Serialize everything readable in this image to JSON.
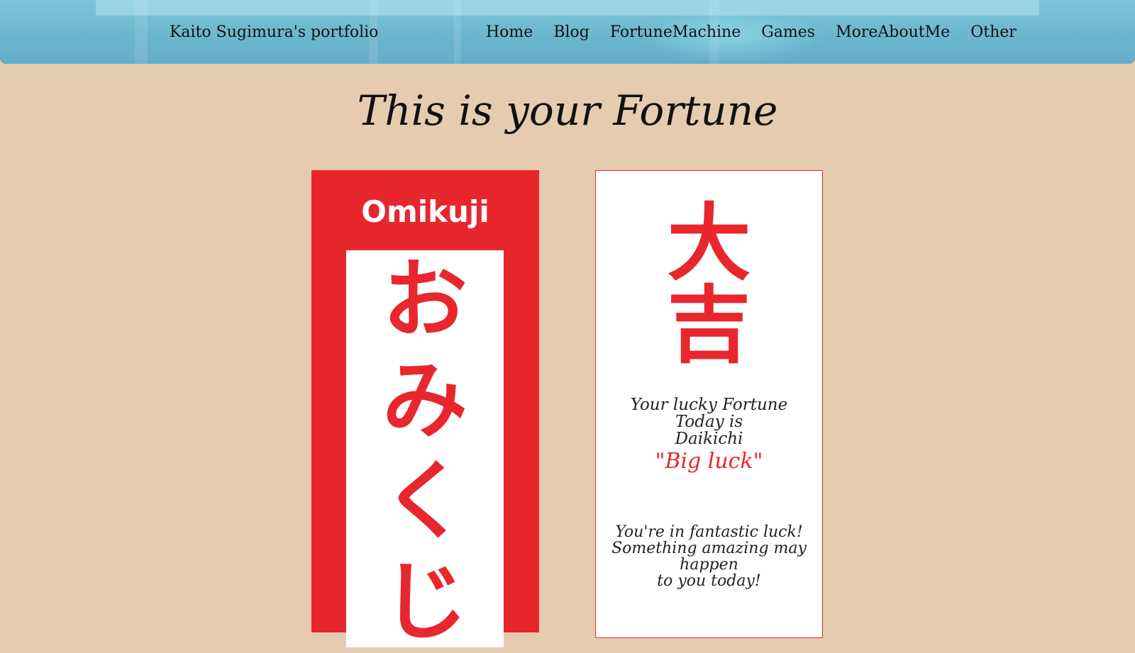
{
  "header": {
    "brand": "Kaito Sugimura's portfolio",
    "nav": [
      {
        "label": "Home"
      },
      {
        "label": "Blog"
      },
      {
        "label": "FortuneMachine"
      },
      {
        "label": "Games"
      },
      {
        "label": "MoreAboutMe"
      },
      {
        "label": "Other"
      }
    ]
  },
  "main": {
    "title": "This is your Fortune",
    "omikuji": {
      "title": "Omikuji",
      "kana": [
        "お",
        "み",
        "く",
        "じ"
      ]
    },
    "fortune": {
      "kanji": [
        "大",
        "吉"
      ],
      "line1": "Your lucky Fortune Today is",
      "line2": "Daikichi",
      "meaning": "\"Big luck\"",
      "desc1": "You're in fantastic luck!",
      "desc2": "Something amazing may happen",
      "desc3": "to you today!"
    }
  },
  "colors": {
    "background": "#e6ccaf",
    "accent_red": "#e8262e",
    "header_blue": "#6cb7cf"
  }
}
